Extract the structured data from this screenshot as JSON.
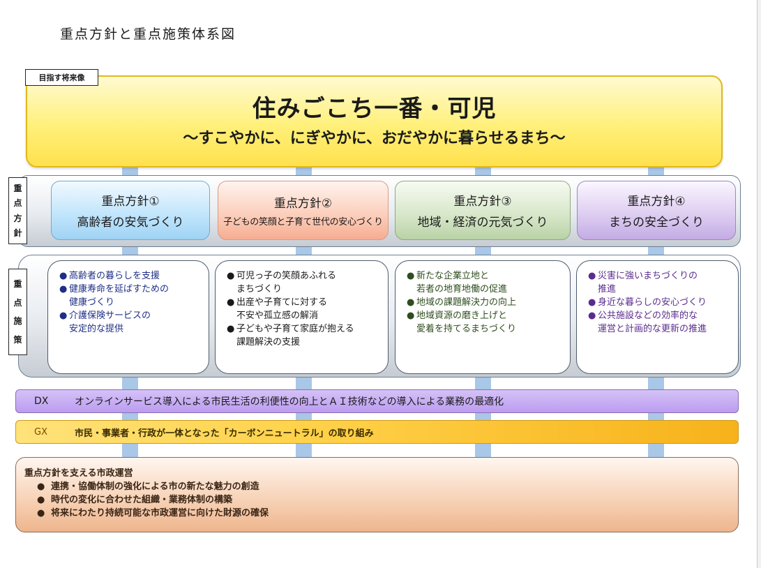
{
  "title": "重点方針と重点施策体系図",
  "vision": {
    "tag": "目指す将来像",
    "main": "住みごこち一番・可児",
    "sub": "～すこやかに、にぎやかに、おだやかに暮らせるまち～"
  },
  "side_labels": {
    "policy": [
      "重",
      "点",
      "方",
      "針"
    ],
    "measure": [
      "重",
      "点",
      "施",
      "策"
    ]
  },
  "policies": [
    {
      "number": "重点方針①",
      "name": "高齢者の安気づくり"
    },
    {
      "number": "重点方針②",
      "name": "子どもの笑顔と子育て世代の安心づくり"
    },
    {
      "number": "重点方針③",
      "name": "地域・経済の元気づくり"
    },
    {
      "number": "重点方針④",
      "name": "まちの安全づくり"
    }
  ],
  "measures": [
    {
      "items": [
        {
          "bullet": "●",
          "lines": [
            "高齢者の暮らしを支援"
          ]
        },
        {
          "bullet": "●",
          "lines": [
            "健康寿命を延ばすための",
            "健康づくり"
          ]
        },
        {
          "bullet": "●",
          "lines": [
            "介護保険サービスの",
            "安定的な提供"
          ]
        }
      ]
    },
    {
      "items": [
        {
          "bullet": "●",
          "lines": [
            "可児っ子の笑顔あふれる",
            "まちづくり"
          ]
        },
        {
          "bullet": "●",
          "lines": [
            "出産や子育てに対する",
            "不安や孤立感の解消"
          ]
        },
        {
          "bullet": "●",
          "lines": [
            "子どもや子育て家庭が抱える",
            "課題解決の支援"
          ]
        }
      ]
    },
    {
      "items": [
        {
          "bullet": "●",
          "lines": [
            "新たな企業立地と",
            "若者の地育地働の促進"
          ]
        },
        {
          "bullet": "●",
          "lines": [
            "地域の課題解決力の向上"
          ]
        },
        {
          "bullet": "●",
          "lines": [
            "地域資源の磨き上げと",
            "愛着を持てるまちづくり"
          ]
        }
      ]
    },
    {
      "items": [
        {
          "bullet": "●",
          "lines": [
            "災害に強いまちづくりの",
            "推進"
          ]
        },
        {
          "bullet": "●",
          "lines": [
            "身近な暮らしの安心づくり"
          ]
        },
        {
          "bullet": "●",
          "lines": [
            "公共施設などの効率的な",
            "運営と計画的な更新の推進"
          ]
        }
      ]
    }
  ],
  "dx": {
    "label": "DX",
    "text": "オンラインサービス導入による市民生活の利便性の向上とＡＩ技術などの導入による業務の最適化"
  },
  "gx": {
    "label": "GX",
    "text": "市民・事業者・行政が一体となった「カーボンニュートラル」の取り組み"
  },
  "support": {
    "title": "重点方針を支える市政運営",
    "bullet": "●",
    "items": [
      "連携・協働体制の強化による市の新たな魅力の創造",
      "時代の変化に合わせた組織・業務体制の構築",
      "将来にわたり持続可能な市政運営に向けた財源の確保"
    ]
  },
  "colors": {
    "vision_fill": "#fff07a",
    "vision_border": "#e3b81c",
    "connector": "#a9c7e6",
    "policy1": "#bfe4fb",
    "policy2": "#fbcdb9",
    "policy3": "#d6e6c8",
    "policy4": "#dccbf0",
    "dx": "#bb9cf0",
    "gx": "#ffd24a",
    "support": "#f7d3b8"
  }
}
